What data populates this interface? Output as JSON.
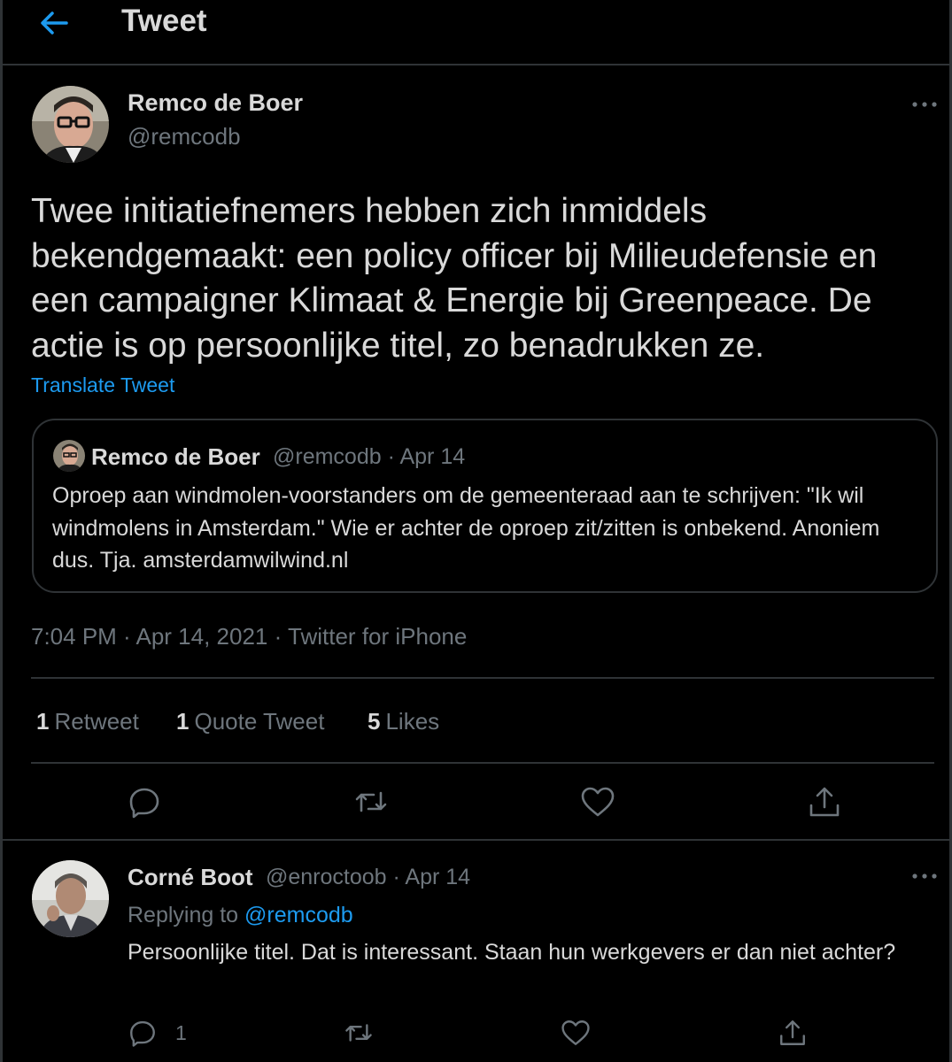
{
  "header": {
    "title": "Tweet",
    "back_icon": "arrow-left-icon",
    "accent": "#1d9bf0"
  },
  "tweet": {
    "author_name": "Remco de Boer",
    "author_handle": "@remcodb",
    "text": "Twee initiatiefnemers hebben zich inmiddels bekendgemaakt: een policy officer bij Milieudefensie en een campaigner Klimaat & Energie bij Greenpeace. De actie is op persoonlijke titel, zo benadrukken ze.",
    "translate_label": "Translate Tweet",
    "timestamp": "7:04 PM · Apr 14, 2021 · Twitter for iPhone",
    "quote": {
      "author_name": "Remco de Boer",
      "meta": "@remcodb · Apr 14",
      "text": "Oproep aan windmolen-voorstanders om de gemeenteraad aan te schrijven: \"Ik wil windmolens in Amsterdam.\" Wie er achter de oproep zit/zitten is onbekend. Anoniem dus. Tja. amsterdamwilwind.nl"
    },
    "stats": {
      "retweets_count": "1",
      "retweets_label": "Retweet",
      "quotes_count": "1",
      "quotes_label": "Quote Tweet",
      "likes_count": "5",
      "likes_label": "Likes"
    },
    "actions": [
      "reply-icon",
      "retweet-icon",
      "like-icon",
      "share-icon"
    ]
  },
  "reply": {
    "author_name": "Corné Boot",
    "meta": "@enroctoob · Apr 14",
    "replying_prefix": "Replying to",
    "replying_mention": "@remcodb",
    "text": "Persoonlijke titel. Dat is interessant. Staan hun werkgevers er dan niet achter?",
    "reply_count": "1"
  },
  "colors": {
    "background": "#000000",
    "text": "#d9d9d9",
    "muted": "#6e767d",
    "border": "#2f3336",
    "link": "#1d9bf0"
  }
}
